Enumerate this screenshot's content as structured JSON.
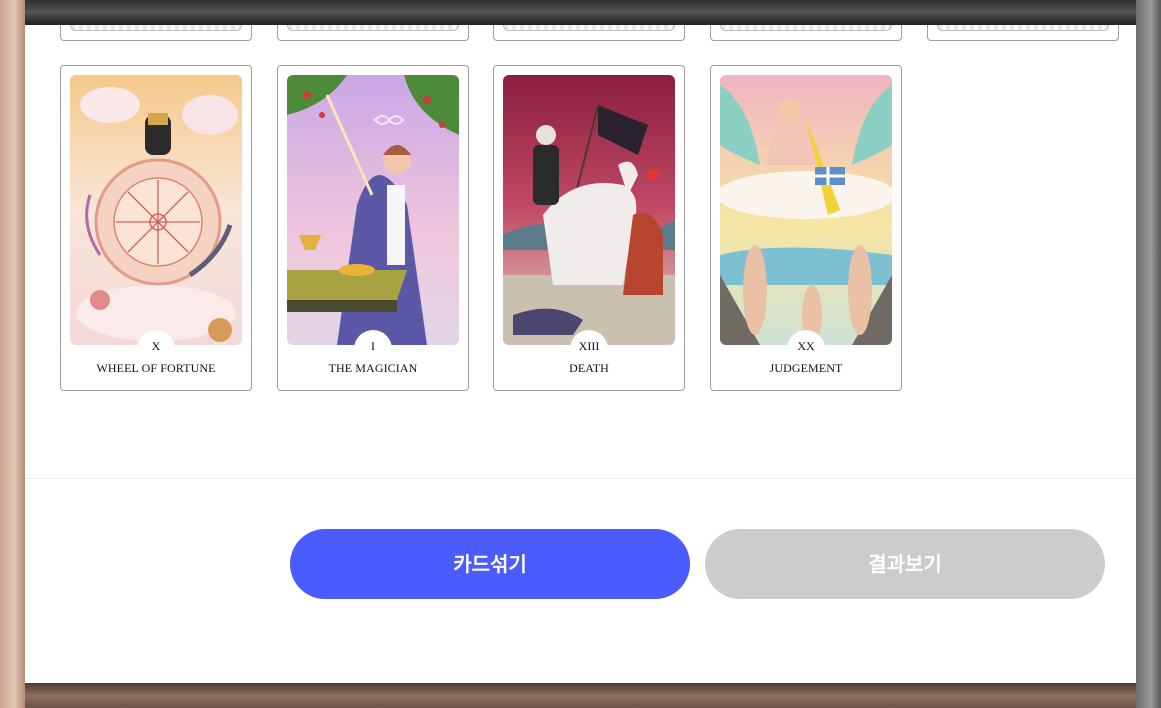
{
  "cards": [
    {
      "numeral": "X",
      "name": "WHEEL OF FORTUNE",
      "art": "wheel-of-fortune-illustration"
    },
    {
      "numeral": "I",
      "name": "THE MAGICIAN",
      "art": "magician-illustration"
    },
    {
      "numeral": "XIII",
      "name": "DEATH",
      "art": "death-illustration"
    },
    {
      "numeral": "XX",
      "name": "JUDGEMENT",
      "art": "judgement-illustration"
    }
  ],
  "buttons": {
    "shuffle_label": "카드섞기",
    "result_label": "결과보기"
  },
  "colors": {
    "primary": "#4a5cff",
    "disabled": "#cccccc"
  }
}
